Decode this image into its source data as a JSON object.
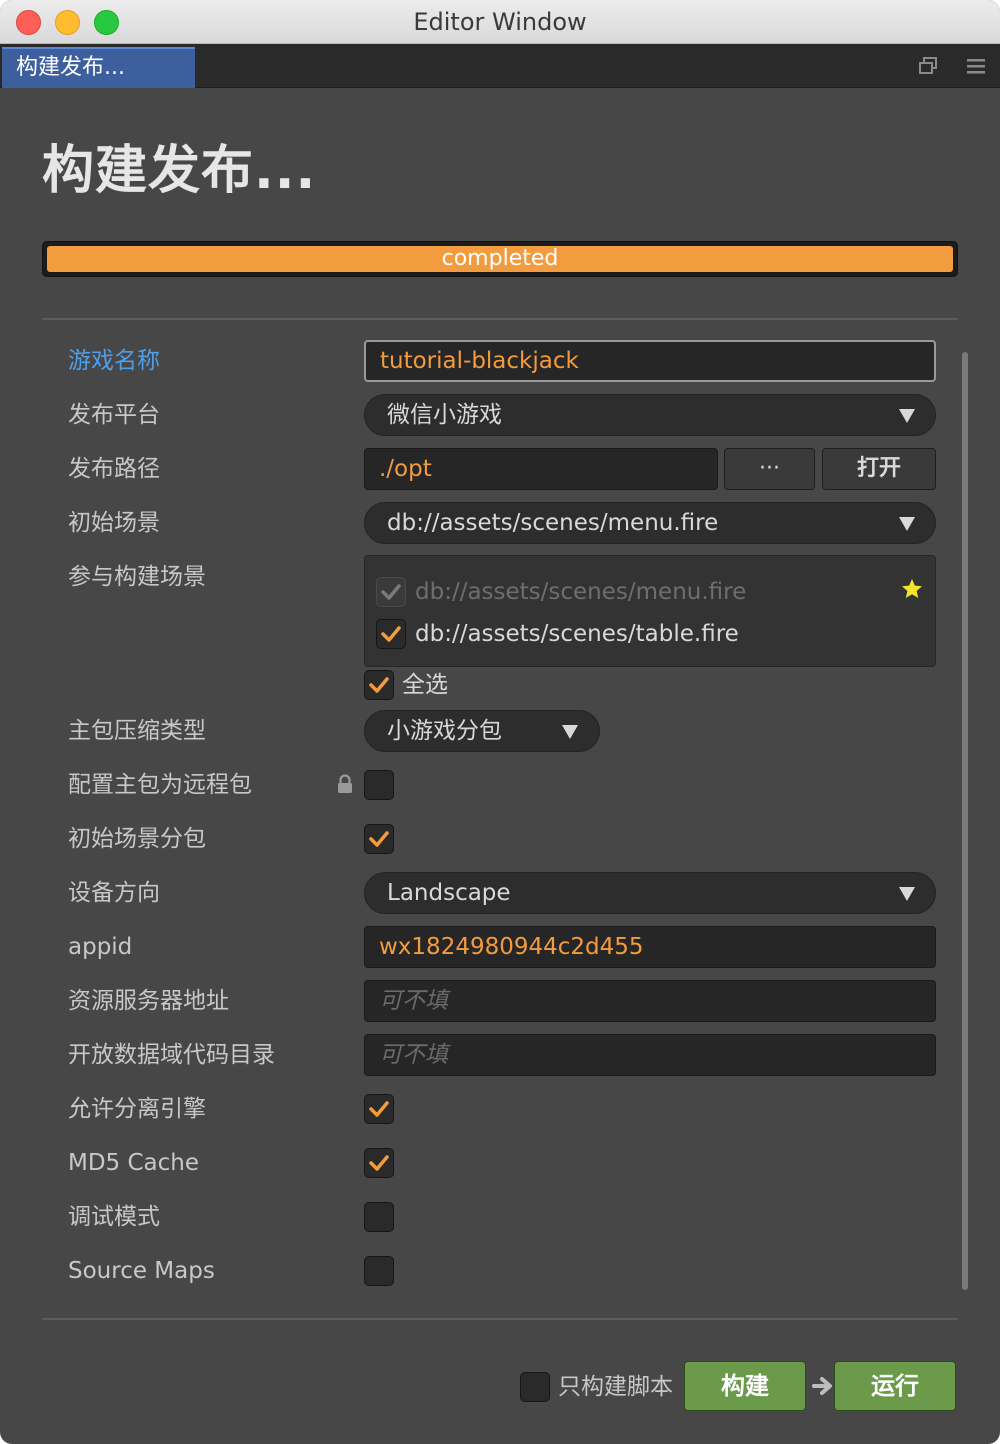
{
  "window": {
    "title": "Editor Window"
  },
  "tab": {
    "label": "构建发布..."
  },
  "page": {
    "title": "构建发布..."
  },
  "progress": {
    "label": "completed",
    "percent": 100
  },
  "form": {
    "game_name": {
      "label": "游戏名称",
      "value": "tutorial-blackjack"
    },
    "platform": {
      "label": "发布平台",
      "value": "微信小游戏"
    },
    "path": {
      "label": "发布路径",
      "value": "./opt",
      "browse_label": "···",
      "open_label": "打开"
    },
    "start_scene": {
      "label": "初始场景",
      "value": "db://assets/scenes/menu.fire"
    },
    "scenes": {
      "label": "参与构建场景",
      "items": [
        {
          "path": "db://assets/scenes/menu.fire",
          "checked": true,
          "disabled": true,
          "starred": true
        },
        {
          "path": "db://assets/scenes/table.fire",
          "checked": true,
          "disabled": false,
          "starred": false
        }
      ],
      "select_all_label": "全选",
      "select_all_checked": true
    },
    "compression": {
      "label": "主包压缩类型",
      "value": "小游戏分包"
    },
    "remote_main": {
      "label": "配置主包为远程包",
      "checked": false
    },
    "start_scene_subpackage": {
      "label": "初始场景分包",
      "checked": true
    },
    "orientation": {
      "label": "设备方向",
      "value": "Landscape"
    },
    "appid": {
      "label": "appid",
      "value": "wx1824980944c2d455"
    },
    "remote_server": {
      "label": "资源服务器地址",
      "placeholder": "可不填"
    },
    "open_data": {
      "label": "开放数据域代码目录",
      "placeholder": "可不填"
    },
    "separate_engine": {
      "label": "允许分离引擎",
      "checked": true
    },
    "md5_cache": {
      "label": "MD5 Cache",
      "checked": true
    },
    "debug": {
      "label": "调试模式",
      "checked": false
    },
    "source_maps": {
      "label": "Source Maps",
      "checked": false
    }
  },
  "footer": {
    "scripts_only_label": "只构建脚本",
    "scripts_only_checked": false,
    "build_label": "构建",
    "run_label": "运行"
  },
  "colors": {
    "accent_orange": "#f29b3f",
    "label_active": "#4d9fec",
    "button_green": "#6a9a4a",
    "star": "#f5e52a"
  }
}
